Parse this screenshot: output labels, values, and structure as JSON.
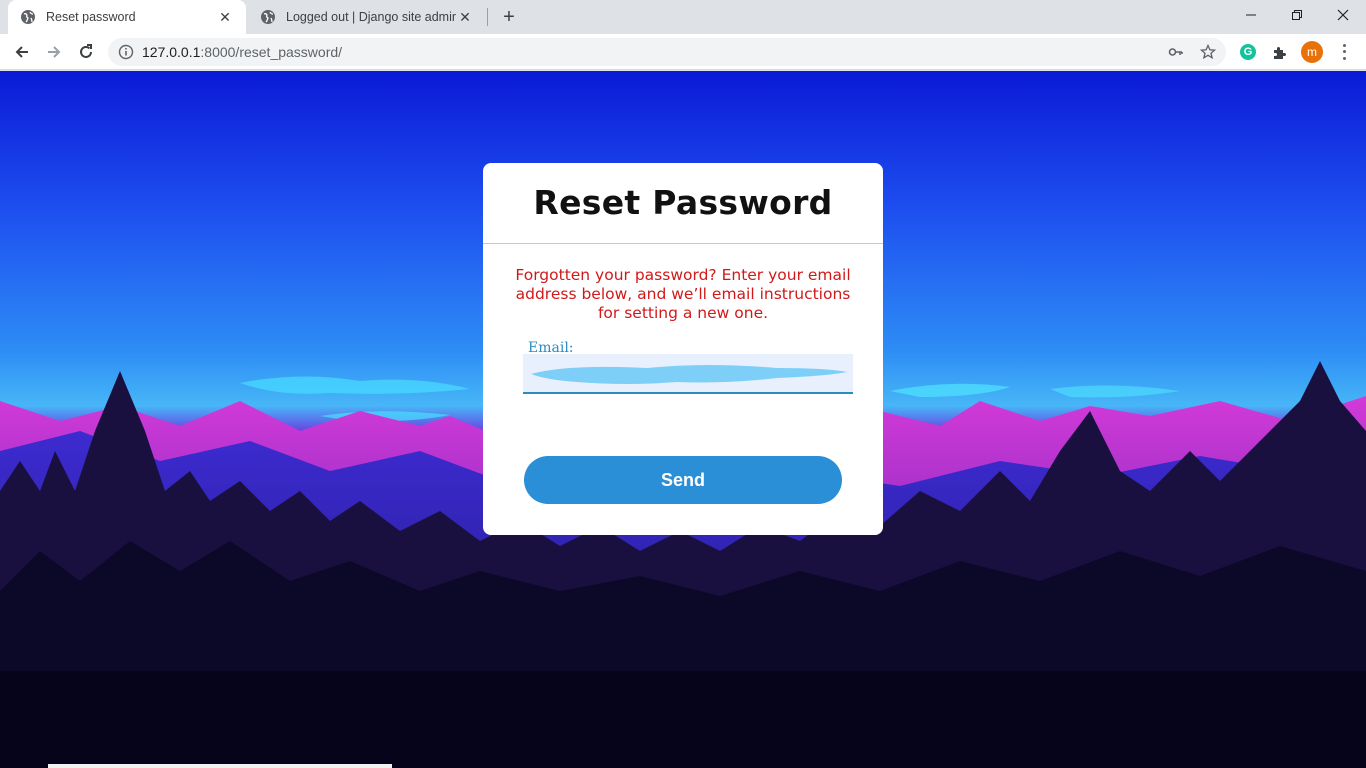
{
  "browser": {
    "tabs": [
      {
        "title": "Reset password",
        "active": true
      },
      {
        "title": "Logged out | Django site admin",
        "active": false
      }
    ],
    "url_host": "127.0.0.1",
    "url_path": ":8000/reset_password/",
    "profile_initial": "m",
    "extension_initial": "G"
  },
  "page": {
    "title": "Reset Password",
    "message": "Forgotten your password? Enter your email address below, and we’ll email instructions for setting a new one.",
    "email_label": "Email:",
    "email_value": "",
    "send_label": "Send"
  },
  "colors": {
    "message": "#d21919",
    "button": "#2a8fd6",
    "accent": "#2b8cc4"
  }
}
